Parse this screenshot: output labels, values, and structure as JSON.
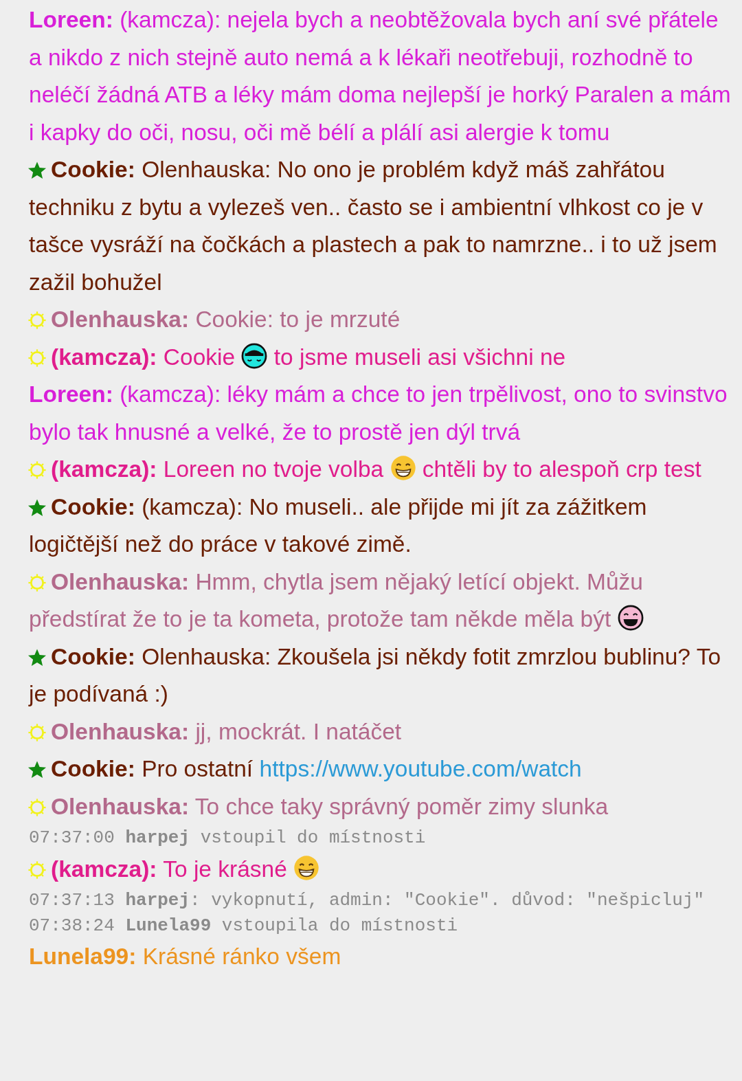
{
  "messages": [
    {
      "kind": "plain",
      "nick": "Loreen:",
      "color": "#d81fd8",
      "parts": [
        {
          "kind": "text",
          "text": "(kamcza): nejela bych a neobtěžovala bych aní své přátele a nikdo z nich stejně auto nemá a k lékaři neotřebuji, rozhodně to neléčí žádná ATB a léky mám doma nejlepší je horký Paralen a mám i kapky do oči, nosu, oči mě bélí a plálí asi alergie k tomu"
        }
      ]
    },
    {
      "kind": "star",
      "nick": "Cookie:",
      "color": "#6a1e00",
      "parts": [
        {
          "kind": "text",
          "text": "Olenhauska: No ono je problém když máš zahřátou techniku z bytu a vylezeš ven.. často se i ambientní vlhkost co je v tašce vysráží na čočkách a plastech a pak to namrzne.. i to už jsem zažil bohužel"
        }
      ]
    },
    {
      "kind": "sun",
      "nick": "Olenhauska:",
      "color": "#b3698b",
      "parts": [
        {
          "kind": "text",
          "text": "Cookie: to je mrzuté"
        }
      ]
    },
    {
      "kind": "sun",
      "nick": "(kamcza):",
      "color": "#e01d8c",
      "parts": [
        {
          "kind": "text",
          "text": "Cookie"
        },
        {
          "kind": "cool"
        },
        {
          "kind": "text",
          "text": "to jsme museli asi všichni ne"
        }
      ]
    },
    {
      "kind": "plain",
      "nick": "Loreen:",
      "color": "#d81fd8",
      "parts": [
        {
          "kind": "text",
          "text": "(kamcza): léky mám a chce to jen trpělivost, ono to svinstvo bylo tak hnusné a velké, že to prostě jen dýl trvá"
        }
      ]
    },
    {
      "kind": "sun",
      "nick": "(kamcza):",
      "color": "#e01d8c",
      "parts": [
        {
          "kind": "text",
          "text": "Loreen no tvoje volba"
        },
        {
          "kind": "grin"
        },
        {
          "kind": "text",
          "text": "chtěli by to alespoň crp test"
        }
      ]
    },
    {
      "kind": "star",
      "nick": "Cookie:",
      "color": "#6a1e00",
      "parts": [
        {
          "kind": "text",
          "text": "(kamcza): No museli.. ale přijde mi jít za zážitkem logičtější než do práce v takové zimě."
        }
      ]
    },
    {
      "kind": "sun",
      "nick": "Olenhauska:",
      "color": "#b3698b",
      "parts": [
        {
          "kind": "text",
          "text": "Hmm, chytla jsem nějaký letící objekt. Můžu předstírat že to je ta kometa, protože tam někde měla být"
        },
        {
          "kind": "laugh"
        }
      ]
    },
    {
      "kind": "star",
      "nick": "Cookie:",
      "color": "#6a1e00",
      "parts": [
        {
          "kind": "text",
          "text": "Olenhauska: Zkoušela jsi někdy fotit zmrzlou bublinu? To je podívaná :)"
        }
      ]
    },
    {
      "kind": "sun",
      "nick": "Olenhauska:",
      "color": "#b3698b",
      "parts": [
        {
          "kind": "text",
          "text": "jj, mockrát. I natáčet"
        }
      ]
    },
    {
      "kind": "star",
      "nick": "Cookie:",
      "color": "#6a1e00",
      "parts": [
        {
          "kind": "text",
          "text": "Pro ostatní"
        },
        {
          "kind": "link",
          "text": "https://www.youtube.com/watch"
        }
      ]
    },
    {
      "kind": "sun",
      "nick": "Olenhauska:",
      "color": "#b3698b",
      "parts": [
        {
          "kind": "text",
          "text": "To chce taky správný poměr zimy slunka"
        }
      ]
    },
    {
      "kind": "system",
      "time": "07:37:00",
      "user": "harpej",
      "text": " vstoupil do místnosti"
    },
    {
      "kind": "sun",
      "nick": "(kamcza):",
      "color": "#e01d8c",
      "parts": [
        {
          "kind": "text",
          "text": "To je krásné"
        },
        {
          "kind": "grin"
        }
      ]
    },
    {
      "kind": "system",
      "time": "07:37:13",
      "user": "harpej",
      "text": ": vykopnutí, admin: \"Cookie\". důvod: \"nešpicluj\""
    },
    {
      "kind": "system",
      "time": "07:38:24",
      "user": "Lunela99",
      "text": " vstoupila do místnosti"
    },
    {
      "kind": "plain",
      "nick": "Lunela99:",
      "color": "#ec9420",
      "parts": [
        {
          "kind": "text",
          "text": "Krásné ránko všem"
        }
      ]
    }
  ]
}
